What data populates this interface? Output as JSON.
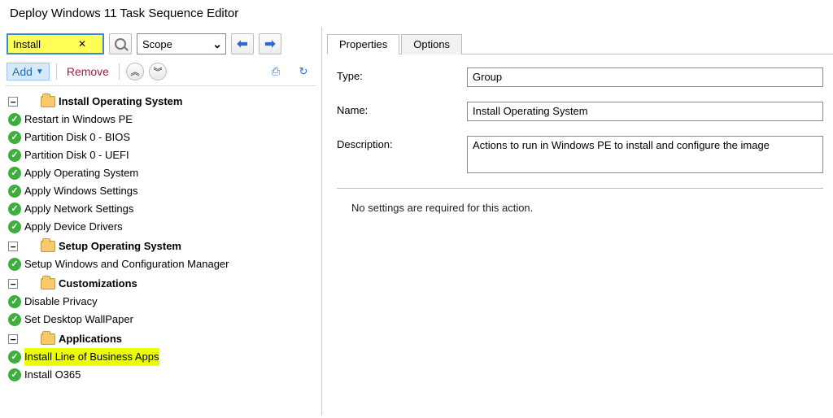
{
  "window": {
    "title": "Deploy Windows 11 Task Sequence Editor"
  },
  "toolbar": {
    "search_value": "Install",
    "scope_label": "Scope",
    "add_label": "Add",
    "remove_label": "Remove"
  },
  "tree": {
    "groups": [
      {
        "label": "Install Operating System",
        "items": [
          "Restart in Windows PE",
          "Partition Disk 0 - BIOS",
          "Partition Disk 0 - UEFI",
          "Apply Operating System",
          "Apply Windows Settings",
          "Apply Network Settings",
          "Apply Device Drivers"
        ]
      },
      {
        "label": "Setup Operating System",
        "items": [
          "Setup Windows and Configuration Manager"
        ]
      },
      {
        "label": "Customizations",
        "items": [
          "Disable Privacy",
          "Set Desktop WallPaper"
        ]
      },
      {
        "label": "Applications",
        "items": [
          "Install Line of Business Apps",
          "Install O365"
        ],
        "highlight_index": 0
      }
    ]
  },
  "tabs": {
    "properties": "Properties",
    "options": "Options"
  },
  "properties": {
    "type_label": "Type:",
    "type_value": "Group",
    "name_label": "Name:",
    "name_value": "Install Operating System",
    "description_label": "Description:",
    "description_value": "Actions to run in Windows PE to install and configure the image",
    "no_settings": "No settings are required for this action."
  }
}
